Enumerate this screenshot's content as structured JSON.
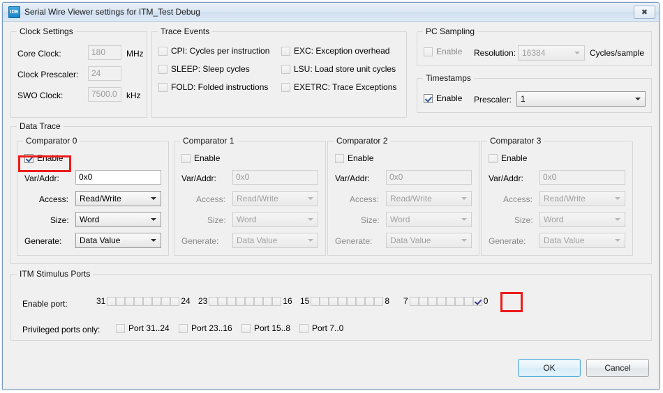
{
  "window": {
    "title": "Serial Wire Viewer settings for ITM_Test Debug",
    "icon": "ide-icon",
    "icon_text": "IDE",
    "close_label": "✖"
  },
  "clock_settings": {
    "legend": "Clock Settings",
    "rows": [
      {
        "label": "Core Clock:",
        "value": "180",
        "unit": "MHz",
        "enabled": false
      },
      {
        "label": "Clock Prescaler:",
        "value": "24",
        "unit": "",
        "enabled": false
      },
      {
        "label": "SWO Clock:",
        "value": "7500.0",
        "unit": "kHz",
        "enabled": false
      }
    ]
  },
  "trace_events": {
    "legend": "Trace Events",
    "items": [
      {
        "label": "CPI: Cycles per instruction",
        "checked": false
      },
      {
        "label": "EXC: Exception overhead",
        "checked": false
      },
      {
        "label": "SLEEP: Sleep cycles",
        "checked": false
      },
      {
        "label": "LSU: Load store unit cycles",
        "checked": false
      },
      {
        "label": "FOLD: Folded instructions",
        "checked": false
      },
      {
        "label": "EXETRC: Trace Exceptions",
        "checked": false
      }
    ]
  },
  "pc_sampling": {
    "legend": "PC Sampling",
    "enable_label": "Enable",
    "enabled": false,
    "resolution_label": "Resolution:",
    "resolution_value": "16384",
    "unit_label": "Cycles/sample"
  },
  "timestamps": {
    "legend": "Timestamps",
    "enable_label": "Enable",
    "enabled": true,
    "prescaler_label": "Prescaler:",
    "prescaler_value": "1"
  },
  "data_trace": {
    "legend": "Data Trace",
    "field_labels": {
      "enable": "Enable",
      "var_addr": "Var/Addr:",
      "access": "Access:",
      "size": "Size:",
      "generate": "Generate:"
    },
    "comparators": [
      {
        "legend": "Comparator 0",
        "enabled": true,
        "var_addr": "0x0",
        "access": "Read/Write",
        "size": "Word",
        "generate": "Data Value"
      },
      {
        "legend": "Comparator 1",
        "enabled": false,
        "var_addr": "0x0",
        "access": "Read/Write",
        "size": "Word",
        "generate": "Data Value"
      },
      {
        "legend": "Comparator 2",
        "enabled": false,
        "var_addr": "0x0",
        "access": "Read/Write",
        "size": "Word",
        "generate": "Data Value"
      },
      {
        "legend": "Comparator 3",
        "enabled": false,
        "var_addr": "0x0",
        "access": "Read/Write",
        "size": "Word",
        "generate": "Data Value"
      }
    ]
  },
  "itm_stimulus": {
    "legend": "ITM Stimulus Ports",
    "enable_port_label": "Enable port:",
    "port_groups": [
      {
        "high": "31",
        "low": "24",
        "checked": [
          false,
          false,
          false,
          false,
          false,
          false,
          false,
          false
        ]
      },
      {
        "high": "23",
        "low": "16",
        "checked": [
          false,
          false,
          false,
          false,
          false,
          false,
          false,
          false
        ]
      },
      {
        "high": "15",
        "low": "8",
        "checked": [
          false,
          false,
          false,
          false,
          false,
          false,
          false,
          false
        ]
      },
      {
        "high": "7",
        "low": "0",
        "checked": [
          false,
          false,
          false,
          false,
          false,
          false,
          false,
          true
        ]
      }
    ],
    "privileged_label": "Privileged ports only:",
    "privileged": [
      {
        "label": "Port 31..24",
        "checked": false
      },
      {
        "label": "Port 23..16",
        "checked": false
      },
      {
        "label": "Port 15..8",
        "checked": false
      },
      {
        "label": "Port 7..0",
        "checked": false
      }
    ]
  },
  "buttons": {
    "ok": "OK",
    "cancel": "Cancel"
  },
  "annotations": {
    "color": "#ee1b1b",
    "count": 2
  }
}
